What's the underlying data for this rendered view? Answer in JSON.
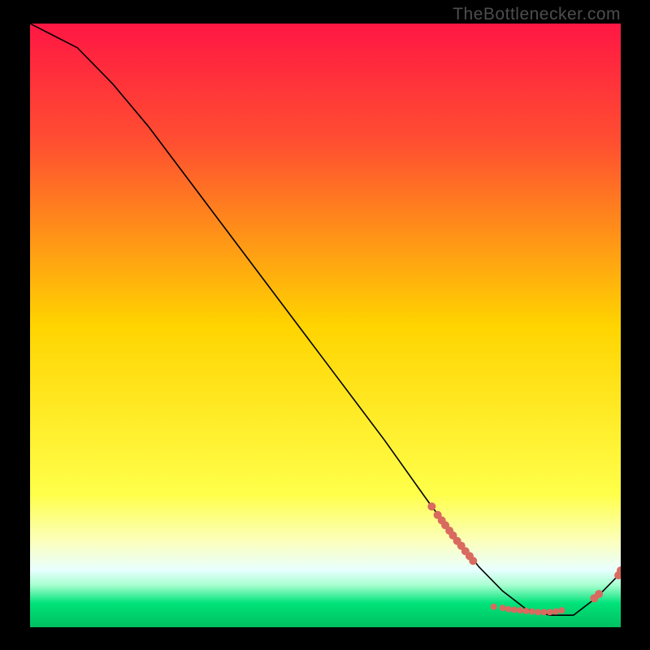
{
  "watermark": "TheBottlenecker.com",
  "chart_data": {
    "type": "line",
    "title": "",
    "xlabel": "",
    "ylabel": "",
    "xlim": [
      0,
      100
    ],
    "ylim": [
      0,
      100
    ],
    "grid": false,
    "background": {
      "type": "vertical-gradient",
      "stops": [
        {
          "pos": 0.0,
          "color": "#ff1744"
        },
        {
          "pos": 0.2,
          "color": "#ff5030"
        },
        {
          "pos": 0.5,
          "color": "#ffd400"
        },
        {
          "pos": 0.78,
          "color": "#ffff4a"
        },
        {
          "pos": 0.86,
          "color": "#fbffc0"
        },
        {
          "pos": 0.905,
          "color": "#e8ffff"
        },
        {
          "pos": 0.93,
          "color": "#a8ffd0"
        },
        {
          "pos": 0.96,
          "color": "#00e37a"
        },
        {
          "pos": 1.0,
          "color": "#00c060"
        }
      ]
    },
    "series": [
      {
        "name": "curve",
        "color": "#000000",
        "stroke_width": 1.6,
        "x": [
          0,
          4,
          8,
          10,
          14,
          20,
          30,
          40,
          50,
          60,
          68,
          72,
          76,
          80,
          84,
          88,
          92,
          96,
          100
        ],
        "y": [
          100,
          98,
          96,
          94,
          90,
          83,
          70,
          57,
          44,
          31,
          20,
          15,
          10,
          6,
          3,
          2,
          2,
          5,
          9
        ]
      }
    ],
    "points": [
      {
        "name": "cluster-descent",
        "color": "#d96a5f",
        "r": 5,
        "data": [
          {
            "x": 68.0,
            "y": 20.0
          },
          {
            "x": 69.0,
            "y": 18.6
          },
          {
            "x": 69.7,
            "y": 17.7
          },
          {
            "x": 70.3,
            "y": 16.9
          },
          {
            "x": 71.0,
            "y": 16.0
          },
          {
            "x": 71.6,
            "y": 15.2
          },
          {
            "x": 72.3,
            "y": 14.3
          },
          {
            "x": 73.0,
            "y": 13.5
          },
          {
            "x": 73.7,
            "y": 12.6
          },
          {
            "x": 74.4,
            "y": 11.8
          },
          {
            "x": 75.0,
            "y": 11.0
          }
        ]
      },
      {
        "name": "cluster-bottom",
        "color": "#d96a5f",
        "r": 4,
        "data": [
          {
            "x": 78.5,
            "y": 3.4
          },
          {
            "x": 80.0,
            "y": 3.2
          },
          {
            "x": 81.0,
            "y": 3.0
          },
          {
            "x": 82.0,
            "y": 2.9
          },
          {
            "x": 83.0,
            "y": 2.8
          },
          {
            "x": 84.0,
            "y": 2.7
          },
          {
            "x": 85.0,
            "y": 2.6
          },
          {
            "x": 86.0,
            "y": 2.5
          },
          {
            "x": 87.0,
            "y": 2.5
          },
          {
            "x": 88.0,
            "y": 2.5
          },
          {
            "x": 89.0,
            "y": 2.6
          },
          {
            "x": 90.0,
            "y": 2.8
          }
        ]
      },
      {
        "name": "cluster-rise",
        "color": "#d96a5f",
        "r": 5,
        "data": [
          {
            "x": 95.5,
            "y": 4.8
          },
          {
            "x": 96.3,
            "y": 5.5
          }
        ]
      },
      {
        "name": "cluster-end",
        "color": "#d96a5f",
        "r": 5,
        "data": [
          {
            "x": 99.6,
            "y": 8.6
          },
          {
            "x": 100.0,
            "y": 9.4
          }
        ]
      }
    ]
  }
}
